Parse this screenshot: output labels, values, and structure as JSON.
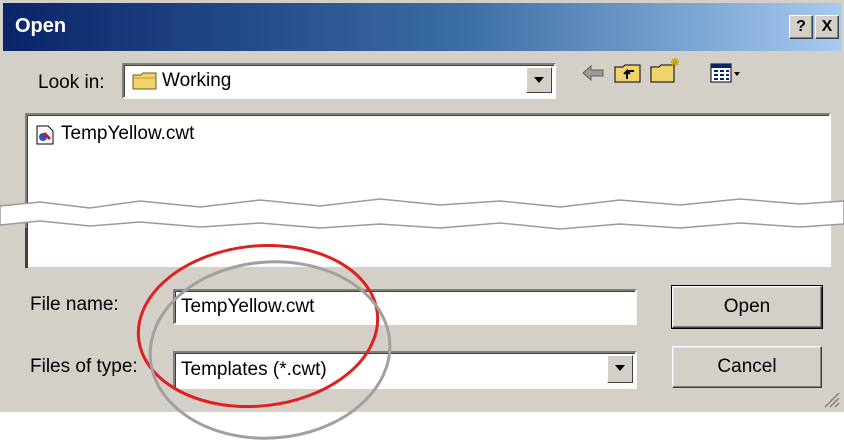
{
  "dialog": {
    "title": "Open",
    "help_label": "?",
    "close_label": "X"
  },
  "look_in": {
    "label": "Look in:",
    "value": "Working"
  },
  "toolbar": {
    "icons": [
      "back-icon",
      "up-folder-icon",
      "new-folder-icon",
      "view-menu-icon"
    ]
  },
  "file_list": {
    "items": [
      {
        "name": "TempYellow.cwt",
        "icon": "template-file-icon"
      }
    ]
  },
  "file_name": {
    "label": "File name:",
    "value": "TempYellow.cwt"
  },
  "files_of_type": {
    "label": "Files of type:",
    "value": "Templates (*.cwt)"
  },
  "buttons": {
    "open_label": "Open",
    "cancel_label": "Cancel"
  },
  "colors": {
    "dialog_face": "#d4d0c8",
    "title_start": "#0a246a",
    "title_end": "#a6caf0",
    "highlight_ellipse": "#e02020",
    "shadow_ellipse": "#a0a0a0"
  }
}
